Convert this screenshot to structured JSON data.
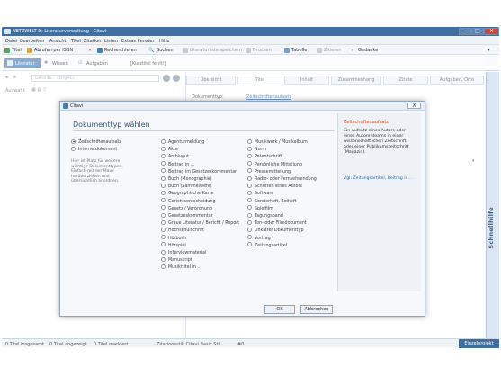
{
  "window": {
    "title": "NETZWELT D: Literaturverwaltung - Citavi"
  },
  "menu": [
    "Datei",
    "Bearbeiten",
    "Ansicht",
    "Titel",
    "Zitation",
    "Listen",
    "Extras",
    "Fenster",
    "Hilfe"
  ],
  "toolbar": {
    "titel": "Titel",
    "abrufen": "Abrufen per ISBN",
    "recherchieren": "Recherchieren",
    "suchen": "Suchen",
    "literaturliste": "Literaturliste speichern",
    "drucken": "Drucken",
    "tabelle": "Tabelle",
    "zitieren": "Zitieren",
    "gedanke": "Gedanke"
  },
  "project_tabs": {
    "literatur": "Literatur",
    "wissen": "Wissen",
    "aufgaben": "Aufgaben",
    "kurztitel": "[Kurztitel fehlt!]"
  },
  "left": {
    "search_placeholder": "Gehe zu... (Strg+E)",
    "auswahl": "Auswahl:"
  },
  "right_tabs": [
    "Übersicht",
    "Titel",
    "Inhalt",
    "Zusammenhang",
    "Zitate",
    "Aufgaben, Orte"
  ],
  "right_fields": {
    "dokumenttyp_label": "Dokumenttyp:",
    "dokumenttyp_value": "Zeitschriftenaufsatz"
  },
  "schnellhilfe": "Schnellhilfe",
  "status": {
    "titel_insgesamt": "0 Titel insgesamt",
    "titel_angezeigt": "0 Titel angezeigt",
    "titel_markiert": "0 Titel markiert",
    "zitationsstil": "Zitationsstil: Citavi Basic Stil",
    "count": "#0",
    "einzelprojekt": "Einzelprojekt"
  },
  "dialog": {
    "title": "Citavi",
    "close": "X",
    "heading": "Dokumenttyp wählen",
    "col1": [
      "Zeitschriftenaufsatz",
      "Internetdokument"
    ],
    "col1_selected": 0,
    "hint": "Hier ist Platz für weitere wichtige Dokumenttypen. Einfach mit der Maus herüberziehen und übersichtlich anordnen.",
    "col2": [
      "Agenturmeldung",
      "Akte",
      "Archivgut",
      "Beitrag in ...",
      "Beitrag im Gesetzeskommentar",
      "Buch (Monographie)",
      "Buch (Sammelwerk)",
      "Geographische Karte",
      "Gerichtsentscheidung",
      "Gesetz / Verordnung",
      "Gesetzeskommentar",
      "Graue Literatur / Bericht / Report",
      "Hochschulschrift",
      "Hörbuch",
      "Hörspiel",
      "Interviewmaterial",
      "Manuskript",
      "Musikttitel in ..."
    ],
    "col3": [
      "Musikwerk / Musikalbum",
      "Norm",
      "Patentschrift",
      "Persönliche Mitteilung",
      "Pressemitteilung",
      "Radio- oder Fernsehsendung",
      "Schriften eines Autors",
      "Software",
      "Sonderheft, Beiheft",
      "Spielfilm",
      "Tagungsband",
      "Ton- oder Filmdokument",
      "Unklarer Dokumenttyp",
      "Vortrag",
      "Zeitungsartikel"
    ],
    "side_title": "Zeitschriftenaufsatz",
    "side_text": "Ein Aufsatz eines Autors oder eines Autorenteams in einer wissenschaftlichen Zeitschrift oder einer Publikumszeitschrift (Magazin).",
    "side_link": "Vgl. Zeitungsartikel, Beitrag in...",
    "ok": "OK",
    "cancel": "Abbrechen"
  }
}
